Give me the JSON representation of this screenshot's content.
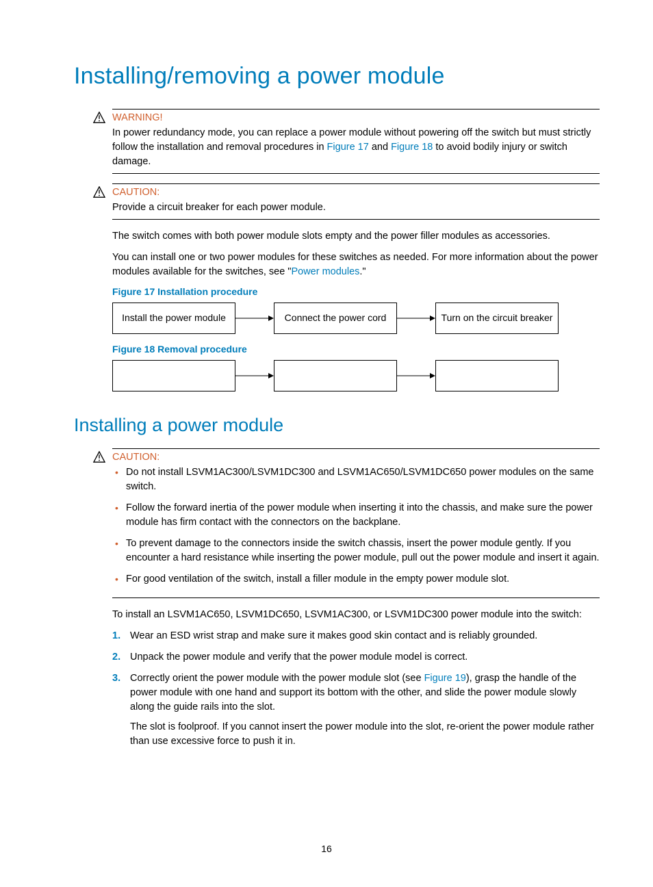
{
  "title": "Installing/removing a power module",
  "warning": {
    "label": "WARNING!",
    "text_before": "In power redundancy mode, you can replace a power module without powering off the switch but must strictly follow the installation and removal procedures in ",
    "link1": "Figure 17",
    "mid": " and ",
    "link2": "Figure 18",
    "text_after": " to avoid bodily injury or switch damage."
  },
  "caution1": {
    "label": "CAUTION:",
    "text": "Provide a circuit breaker for each power module."
  },
  "para1": "The switch comes with both power module slots empty and the power filler modules as accessories.",
  "para2_before": "You can install one or two power modules for these switches as needed. For more information about the power modules available for the switches, see \"",
  "para2_link": "Power modules",
  "para2_after": ".\"",
  "fig17_caption": "Figure 17 Installation procedure",
  "fig17": {
    "b1": "Install the power module",
    "b2": "Connect the power cord",
    "b3": "Turn on the circuit breaker"
  },
  "fig18_caption": "Figure 18 Removal procedure",
  "fig18": {
    "b1": "",
    "b2": "",
    "b3": ""
  },
  "subtitle": "Installing a power module",
  "caution2": {
    "label": "CAUTION:",
    "items": [
      "Do not install LSVM1AC300/LSVM1DC300 and LSVM1AC650/LSVM1DC650 power modules on the same switch.",
      "Follow the forward inertia of the power module when inserting it into the chassis, and make sure the power module has firm contact with the connectors on the backplane.",
      "To prevent damage to the connectors inside the switch chassis, insert the power module gently. If you encounter a hard resistance while inserting the power module, pull out the power module and insert it again.",
      "For good ventilation of the switch, install a filler module in the empty power module slot."
    ]
  },
  "intro": "To install an LSVM1AC650, LSVM1DC650, LSVM1AC300, or LSVM1DC300 power module into the switch:",
  "steps": {
    "s1": "Wear an ESD wrist strap and make sure it makes good skin contact and is reliably grounded.",
    "s2": "Unpack the power module and verify that the power module model is correct.",
    "s3_before": "Correctly orient the power module with the power module slot (see ",
    "s3_link": "Figure 19",
    "s3_after": "), grasp the handle of the power module with one hand and support its bottom with the other, and slide the power module slowly along the guide rails into the slot.",
    "s3_sub": "The slot is foolproof. If you cannot insert the power module into the slot, re-orient the power module rather than use excessive force to push it in."
  },
  "pagenum": "16"
}
